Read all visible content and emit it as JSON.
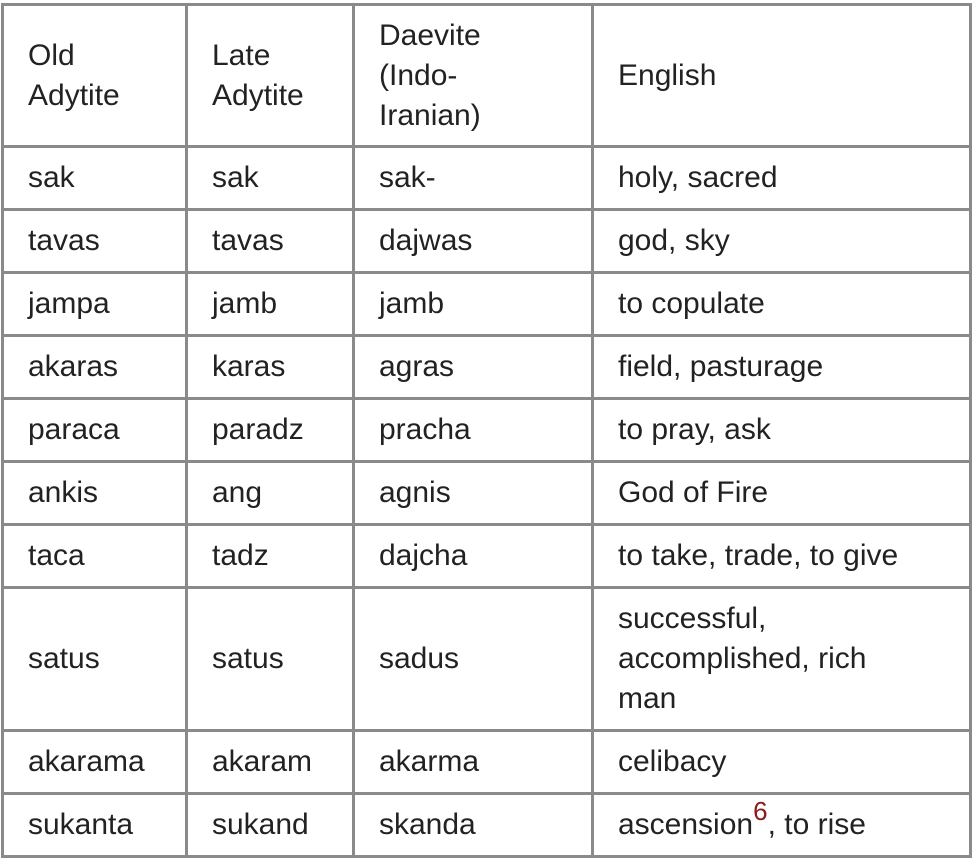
{
  "table": {
    "headers": [
      "Old Adytite",
      "Late Adytite",
      "Daevite (Indo-Iranian)",
      "English"
    ],
    "rows": [
      {
        "old": "sak",
        "late": "sak",
        "daevite": "sak-",
        "english": "holy, sacred"
      },
      {
        "old": "tavas",
        "late": "tavas",
        "daevite": "dajwas",
        "english": "god, sky"
      },
      {
        "old": "jampa",
        "late": "jamb",
        "daevite": "jamb",
        "english": "to copulate"
      },
      {
        "old": "akaras",
        "late": "karas",
        "daevite": "agras",
        "english": "field, pasturage"
      },
      {
        "old": "paraca",
        "late": "paradz",
        "daevite": "pracha",
        "english": "to pray, ask"
      },
      {
        "old": "ankis",
        "late": "ang",
        "daevite": "agnis",
        "english": "God of Fire"
      },
      {
        "old": "taca",
        "late": "tadz",
        "daevite": "dajcha",
        "english": "to take, trade, to give"
      },
      {
        "old": "satus",
        "late": "satus",
        "daevite": "sadus",
        "english": "successful, accomplished, rich man"
      },
      {
        "old": "akarama",
        "late": "akaram",
        "daevite": "akarma",
        "english": "celibacy"
      },
      {
        "old": "sukanta",
        "late": "sukand",
        "daevite": "skanda",
        "english": "ascension",
        "footnote": "6",
        "english_suffix": ", to rise"
      }
    ]
  },
  "colors": {
    "text": "#222222",
    "border": "#8a8a8a",
    "footnote": "#8b1a1a"
  }
}
